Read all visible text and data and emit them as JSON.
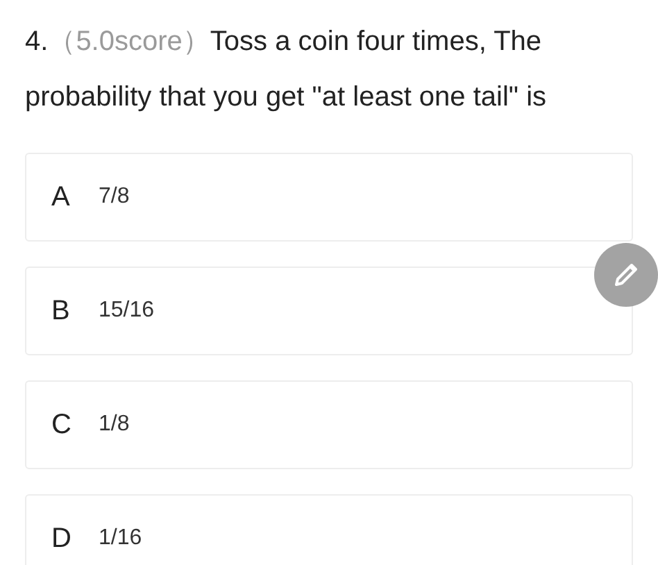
{
  "question": {
    "number": "4.",
    "score": "（5.0score）",
    "text": "Toss a coin four times, The probability that you get \"at least one tail\" is"
  },
  "options": [
    {
      "letter": "A",
      "text": "7/8"
    },
    {
      "letter": "B",
      "text": "15/16"
    },
    {
      "letter": "C",
      "text": "1/8"
    },
    {
      "letter": "D",
      "text": "1/16"
    }
  ]
}
